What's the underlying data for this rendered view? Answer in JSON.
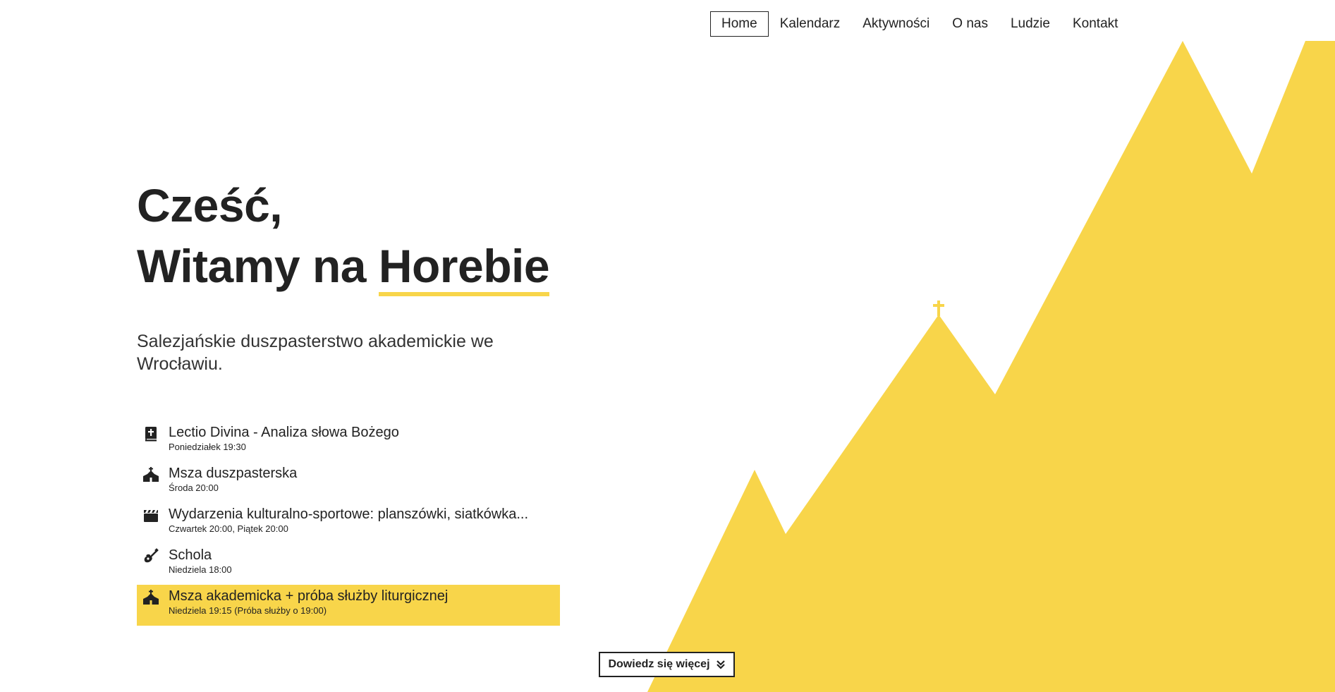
{
  "colors": {
    "accent": "#f8d54a",
    "text": "#222222",
    "background": "#ffffff"
  },
  "nav": {
    "items": [
      {
        "label": "Home",
        "active": true
      },
      {
        "label": "Kalendarz"
      },
      {
        "label": "Aktywności"
      },
      {
        "label": "O nas"
      },
      {
        "label": "Ludzie"
      },
      {
        "label": "Kontakt"
      }
    ]
  },
  "hero": {
    "line1": "Cześć,",
    "line2_prefix": "Witamy na ",
    "line2_highlight": "Horebie",
    "subtitle": "Salezjańskie duszpasterstwo akademickie we Wrocławiu."
  },
  "schedule": [
    {
      "icon": "bible-icon",
      "title": "Lectio Divina - Analiza słowa Bożego",
      "time": "Poniedziałek 19:30"
    },
    {
      "icon": "church-icon",
      "title": "Msza duszpasterska",
      "time": "Środa 20:00"
    },
    {
      "icon": "clapperboard-icon",
      "title": "Wydarzenia kulturalno-sportowe: planszówki, siatkówka...",
      "time": "Czwartek 20:00, Piątek 20:00"
    },
    {
      "icon": "guitar-icon",
      "title": "Schola",
      "time": "Niedziela 18:00"
    },
    {
      "icon": "church-icon",
      "title": "Msza akademicka + próba służby liturgicznej",
      "time": "Niedziela 19:15 (Próba służby o 19:00)",
      "highlighted": true
    }
  ],
  "cta": {
    "label": "Dowiedz się więcej",
    "icon": "double-chevron-down-icon"
  }
}
